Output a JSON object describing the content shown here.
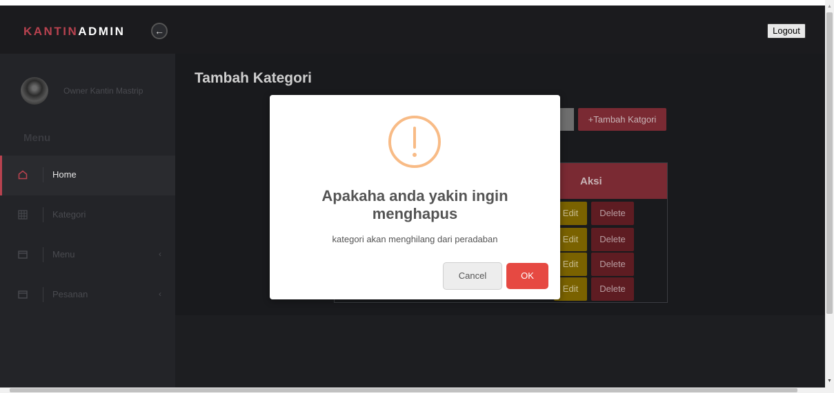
{
  "brand": {
    "part1": "KANTIN",
    "part2": "ADMIN"
  },
  "header": {
    "logout_label": "Logout",
    "back_icon": "arrow-left-icon"
  },
  "sidebar": {
    "profile_name": "Owner Kantin Mastrip",
    "menu_heading": "Menu",
    "items": [
      {
        "label": "Home",
        "icon": "home-icon",
        "active": true,
        "chevron": ""
      },
      {
        "label": "Kategori",
        "icon": "grid-icon",
        "active": false,
        "chevron": ""
      },
      {
        "label": "Menu",
        "icon": "window-icon",
        "active": false,
        "chevron": "‹"
      },
      {
        "label": "Pesanan",
        "icon": "window-icon",
        "active": false,
        "chevron": "‹"
      }
    ]
  },
  "main": {
    "page_title": "Tambah Kategori",
    "add_button_label": "+Tambah Katgori",
    "table": {
      "action_header": "Aksi",
      "rows": [
        {
          "edit_label": "Edit",
          "delete_label": "Delete"
        },
        {
          "edit_label": "Edit",
          "delete_label": "Delete"
        },
        {
          "edit_label": "Edit",
          "delete_label": "Delete"
        },
        {
          "edit_label": "Edit",
          "delete_label": "Delete"
        }
      ]
    }
  },
  "modal": {
    "icon": "warning-icon",
    "title": "Apakaha anda yakin ingin menghapus",
    "text": "kategori akan menghilang dari peradaban",
    "cancel_label": "Cancel",
    "ok_label": "OK"
  },
  "colors": {
    "accent": "#b8424f",
    "ok_button": "#e64942",
    "warning": "#f8bb86"
  }
}
